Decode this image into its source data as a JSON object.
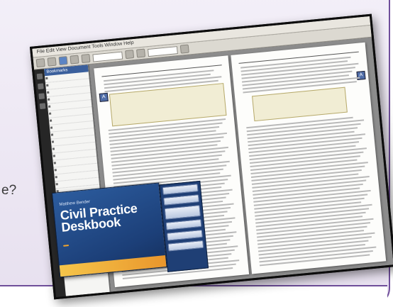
{
  "edge_text": "e?",
  "app": {
    "menu_text": "File  Edit  View  Document  Tools  Window  Help"
  },
  "bookmarks": {
    "header": "Bookmarks",
    "items": [
      "",
      "",
      "",
      "",
      "",
      "",
      "",
      "",
      "",
      "",
      "",
      "",
      "",
      "",
      "",
      "",
      "",
      "",
      "",
      "",
      "",
      "",
      "",
      "",
      "",
      "",
      "",
      ""
    ]
  },
  "product": {
    "publisher": "Matthew Bender",
    "title_line1": "Civil Practice",
    "title_line2": "Deskbook",
    "edition": "",
    "badge": "",
    "menu": [
      "",
      "",
      "",
      "",
      "",
      ""
    ]
  },
  "colors": {
    "frame_purple": "#6f4e9a",
    "product_blue": "#2c5c9e",
    "note_yellow": "#f1edd4"
  }
}
